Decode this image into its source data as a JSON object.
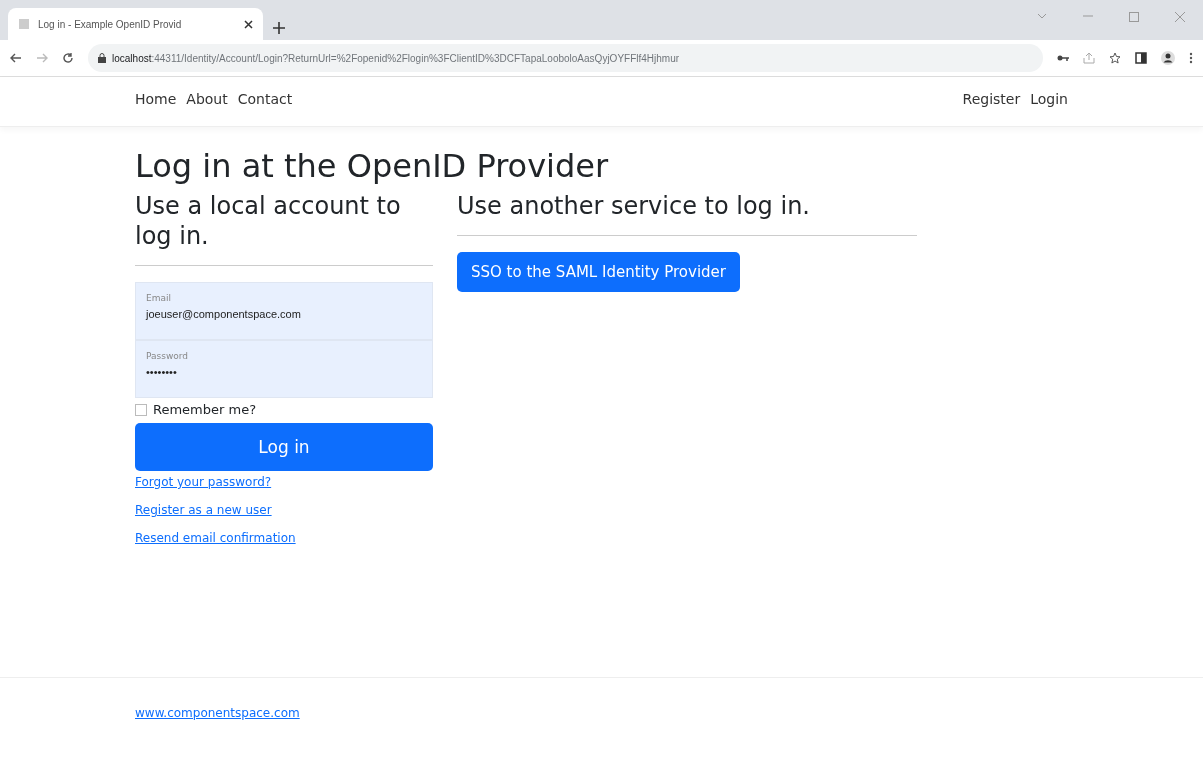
{
  "browser": {
    "tab_title": "Log in - Example OpenID Provid",
    "url_host": "localhost",
    "url_path": ":44311/Identity/Account/Login?ReturnUrl=%2Fopenid%2Flogin%3FClientID%3DCFTapaLooboloAasQyjOYFFlf4Hjhmur"
  },
  "nav": {
    "left": [
      "Home",
      "About",
      "Contact"
    ],
    "right": [
      "Register",
      "Login"
    ]
  },
  "title": "Log in at the OpenID Provider",
  "local": {
    "heading": "Use a local account to log in.",
    "fields": [
      {
        "label": "Email",
        "value": "joeuser@componentspace.com"
      },
      {
        "label": "Password",
        "value": "••••••••"
      }
    ],
    "remember": {
      "label": "Remember me?",
      "checked": false
    },
    "submit": "Log in",
    "links": [
      "Forgot your password?",
      "Register as a new user",
      "Resend email confirmation"
    ]
  },
  "external": {
    "heading": "Use another service to log in.",
    "button": "SSO to the SAML Identity Provider"
  },
  "footer": {
    "link": "www.componentspace.com"
  }
}
